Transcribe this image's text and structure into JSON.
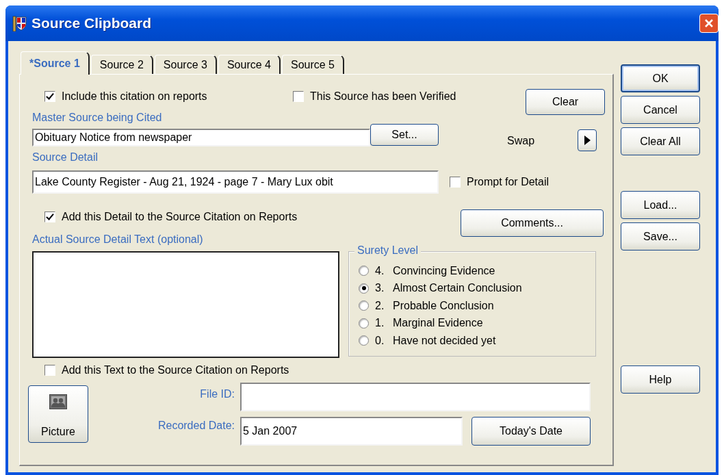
{
  "window": {
    "title": "Source Clipboard"
  },
  "tabs": [
    {
      "label": "*Source 1",
      "selected": true
    },
    {
      "label": "Source 2",
      "selected": false
    },
    {
      "label": "Source 3",
      "selected": false
    },
    {
      "label": "Source 4",
      "selected": false
    },
    {
      "label": "Source 5",
      "selected": false
    }
  ],
  "include_citation": {
    "label": "Include this citation on reports",
    "checked": true
  },
  "verified": {
    "label": "This Source has been Verified",
    "checked": false
  },
  "clear_button": "Clear",
  "master_source": {
    "label": "Master Source being Cited",
    "value": "Obituary Notice from newspaper",
    "button": "Set..."
  },
  "swap": {
    "label": "Swap"
  },
  "source_detail": {
    "label": "Source Detail",
    "value": "Lake County Register - Aug 21, 1924 - page 7 - Mary Lux obit"
  },
  "prompt_for_detail": {
    "label": "Prompt for Detail",
    "checked": false
  },
  "add_detail": {
    "label": "Add this Detail to the Source Citation on Reports",
    "checked": true
  },
  "comments_button": "Comments...",
  "detail_text": {
    "label": "Actual Source Detail Text (optional)"
  },
  "surety": {
    "title": "Surety Level",
    "options": [
      {
        "number": "4.",
        "label": "Convincing Evidence",
        "selected": false
      },
      {
        "number": "3.",
        "label": "Almost Certain Conclusion",
        "selected": true
      },
      {
        "number": "2.",
        "label": "Probable Conclusion",
        "selected": false
      },
      {
        "number": "1.",
        "label": "Marginal Evidence",
        "selected": false
      },
      {
        "number": "0.",
        "label": "Have not decided yet",
        "selected": false
      }
    ]
  },
  "add_text": {
    "label": "Add this Text to the Source Citation on Reports",
    "checked": false
  },
  "picture_button": "Picture",
  "file_id": {
    "label": "File ID:"
  },
  "recorded_date": {
    "label": "Recorded Date:",
    "value": "5 Jan 2007"
  },
  "todays_date_button": "Today's Date",
  "side_buttons": [
    [
      {
        "label": "OK",
        "default": true
      },
      {
        "label": "Cancel",
        "default": false
      },
      {
        "label": "Clear All",
        "default": false
      }
    ],
    [
      {
        "label": "Load...",
        "default": false
      },
      {
        "label": "Save...",
        "default": false
      }
    ],
    [
      {
        "label": "Help",
        "default": false
      }
    ]
  ]
}
